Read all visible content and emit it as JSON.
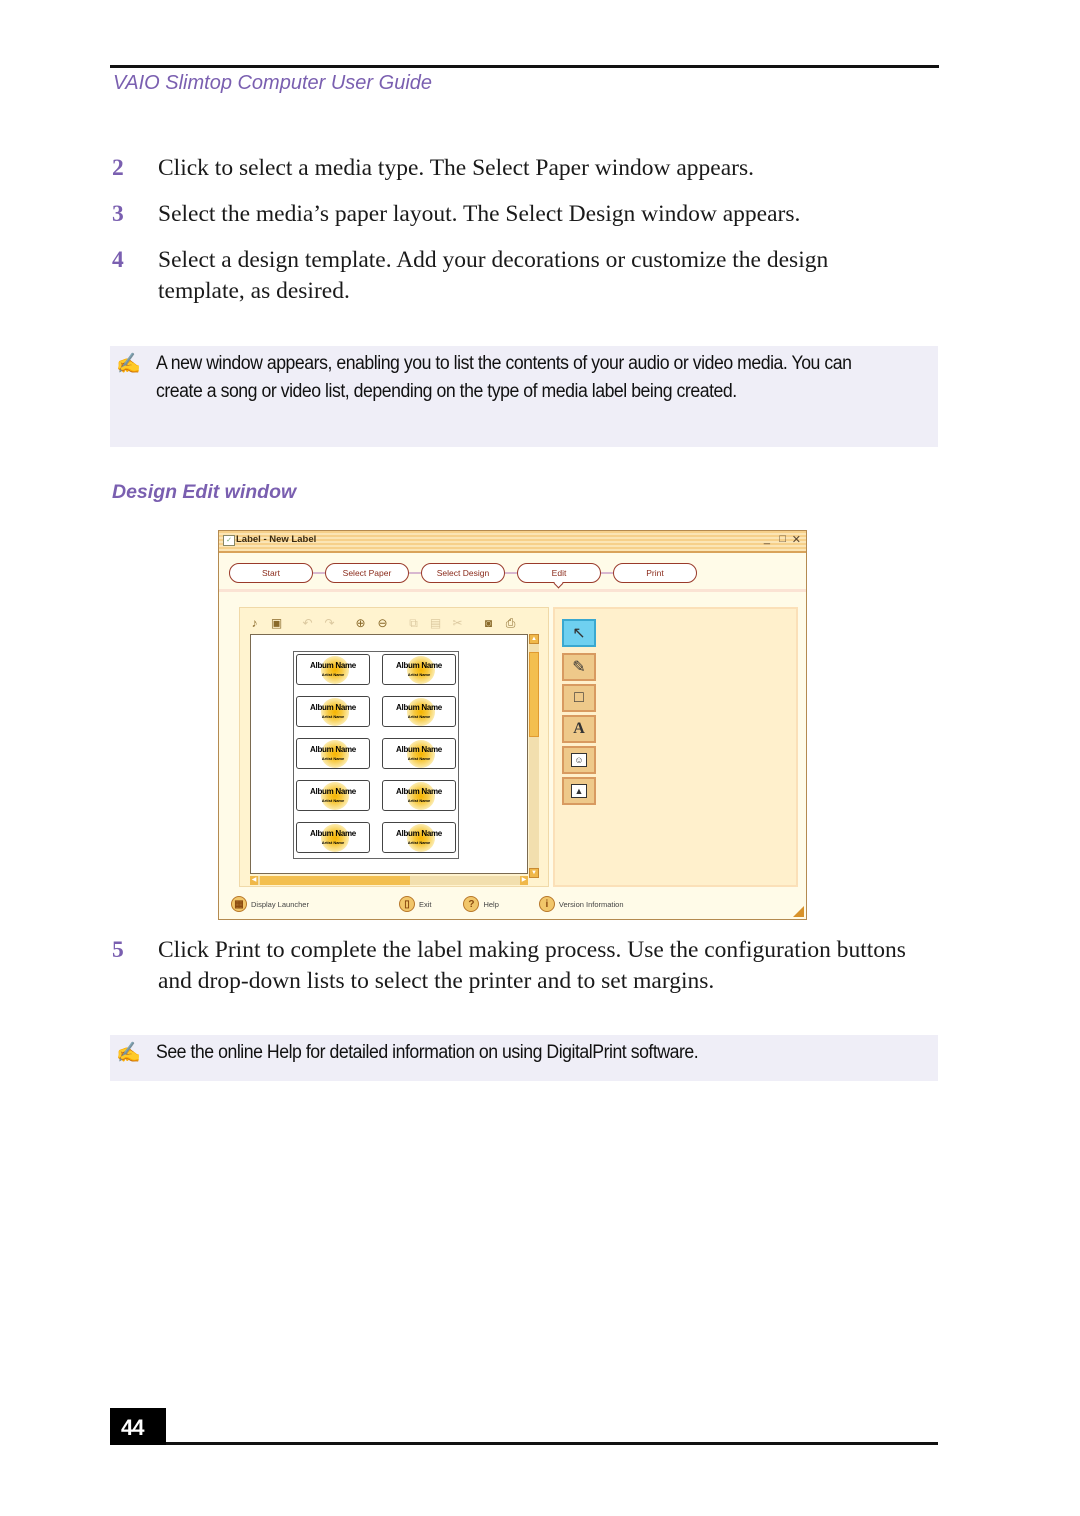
{
  "header": {
    "running_title": "VAIO Slimtop Computer User Guide"
  },
  "steps": [
    {
      "num": "2",
      "text": "Click to select a media type. The Select Paper window appears."
    },
    {
      "num": "3",
      "text": "Select the media’s paper layout. The Select Design window appears."
    },
    {
      "num": "4",
      "text": "Select a design template. Add your decorations or customize the design template, as desired."
    },
    {
      "num": "5",
      "text": "Click Print to complete the label making process. Use the configuration buttons and drop-down lists to select the printer and to set margins."
    }
  ],
  "notes": [
    {
      "icon": "note-pen-icon",
      "text": "A new window appears, enabling you to list the contents of your audio or video media. You can create a song or video list, depending on the type of media label being created."
    },
    {
      "icon": "note-pen-icon",
      "text": "See the online Help for detailed information on using DigitalPrint software."
    }
  ],
  "figure": {
    "caption": "Design Edit window"
  },
  "app": {
    "title": "Label - New Label",
    "window_controls": {
      "minimize": "_",
      "maximize": "□",
      "close": "✕"
    },
    "wizard_steps": [
      {
        "label": "Start",
        "active": false
      },
      {
        "label": "Select Paper",
        "active": false
      },
      {
        "label": "Select Design",
        "active": false
      },
      {
        "label": "Edit",
        "active": true
      },
      {
        "label": "Print",
        "active": false
      }
    ],
    "toolbar": [
      {
        "name": "import-music-icon",
        "glyph": "♪",
        "enabled": true
      },
      {
        "name": "save-icon",
        "glyph": "▣",
        "enabled": true
      },
      {
        "name": "undo-icon",
        "glyph": "↶",
        "enabled": false
      },
      {
        "name": "redo-icon",
        "glyph": "↷",
        "enabled": false
      },
      {
        "name": "zoom-in-icon",
        "glyph": "⊕",
        "enabled": true
      },
      {
        "name": "zoom-out-icon",
        "glyph": "⊖",
        "enabled": true
      },
      {
        "name": "copy-icon",
        "glyph": "⧉",
        "enabled": false
      },
      {
        "name": "paste-icon",
        "glyph": "▤",
        "enabled": false
      },
      {
        "name": "cut-icon",
        "glyph": "✂",
        "enabled": false
      },
      {
        "name": "fill-icon",
        "glyph": "◙",
        "enabled": true
      },
      {
        "name": "print-icon",
        "glyph": "⎙",
        "enabled": true
      }
    ],
    "labels": {
      "album_name": "Album Name",
      "artist_name": "Artist Name",
      "rows": 5,
      "cols": 2
    },
    "tools": [
      {
        "name": "select-arrow-tool",
        "glyph": "↖",
        "selected": true
      },
      {
        "name": "pencil-tool",
        "glyph": "✎",
        "selected": false
      },
      {
        "name": "rectangle-tool",
        "glyph": "□",
        "selected": false
      },
      {
        "name": "text-tool",
        "glyph": "A",
        "selected": false
      },
      {
        "name": "clipart-tool",
        "glyph": "ʕ•ᴥ•ʔ",
        "selected": false
      },
      {
        "name": "image-tool",
        "glyph": "▲",
        "selected": false
      }
    ],
    "bottom_buttons": [
      {
        "name": "display-launcher",
        "glyph": "▦",
        "label": "Display Launcher"
      },
      {
        "name": "exit",
        "glyph": "▯",
        "label": "Exit"
      },
      {
        "name": "help",
        "glyph": "?",
        "label": "Help"
      },
      {
        "name": "version-information",
        "glyph": "i",
        "label": "Version Information"
      }
    ]
  },
  "footer": {
    "page_number": "44"
  }
}
